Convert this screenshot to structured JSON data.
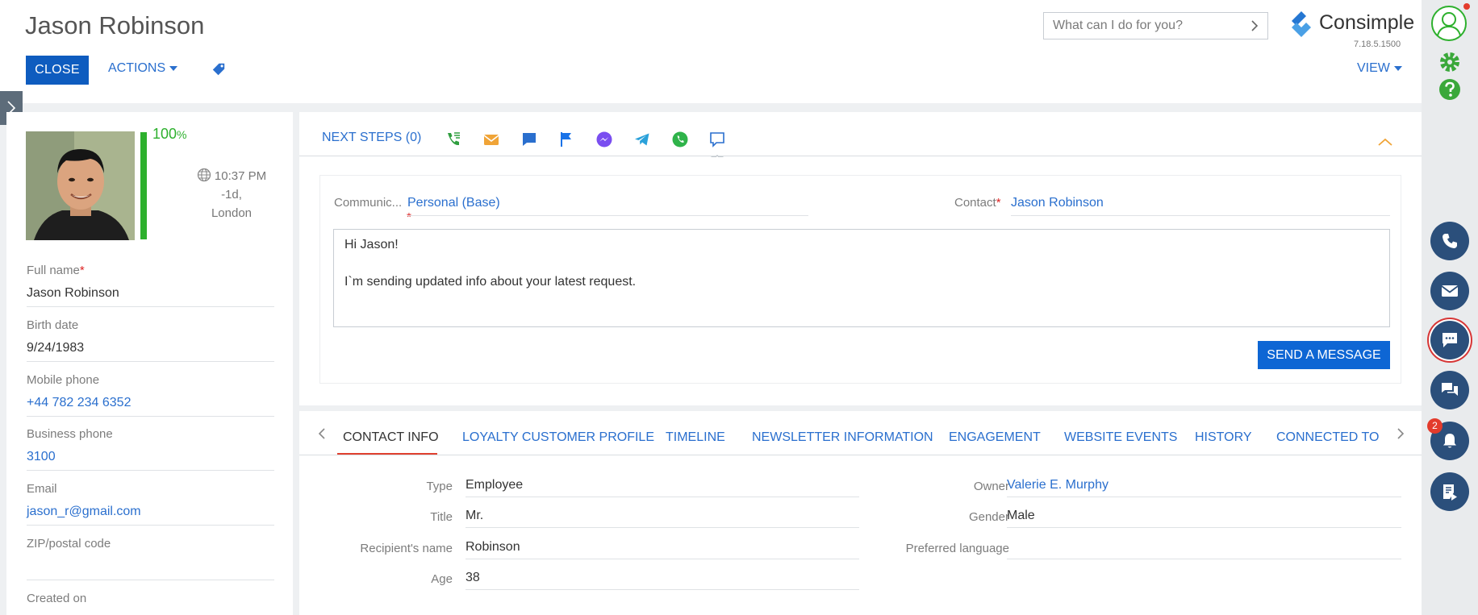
{
  "header": {
    "title": "Jason Robinson",
    "close_label": "CLOSE",
    "actions_label": "ACTIONS",
    "view_label": "VIEW",
    "search_placeholder": "What can I do for you?",
    "logo_text": "Consimple",
    "version": "7.18.5.1500"
  },
  "profile": {
    "completeness_value": "100",
    "completeness_unit": "%",
    "completeness_fraction": 1.0,
    "local_time": "10:37 PM",
    "offset": "-1d,",
    "city": "London"
  },
  "left_fields": [
    {
      "label": "Full name",
      "required": true,
      "value": "Jason Robinson",
      "link": false
    },
    {
      "label": "Birth date",
      "required": false,
      "value": "9/24/1983",
      "link": false
    },
    {
      "label": "Mobile phone",
      "required": false,
      "value": "+44 782 234 6352",
      "link": true
    },
    {
      "label": "Business phone",
      "required": false,
      "value": "3100",
      "link": true
    },
    {
      "label": "Email",
      "required": false,
      "value": "jason_r@gmail.com",
      "link": true
    },
    {
      "label": "ZIP/postal code",
      "required": false,
      "value": "",
      "link": false
    },
    {
      "label": "Created on",
      "required": false,
      "value": "",
      "link": false
    }
  ],
  "next_steps": {
    "label": "NEXT STEPS (0)"
  },
  "compose": {
    "channel_label": "Communic...",
    "channel_value": "Personal (Base)",
    "contact_label": "Contact",
    "contact_value": "Jason Robinson",
    "message_line1": "Hi Jason!",
    "message_line2": "",
    "message_line3": "I`m sending updated info about your latest request.",
    "send_label": "SEND A MESSAGE"
  },
  "detail_tabs": [
    {
      "label": "CONTACT INFO",
      "active": true
    },
    {
      "label": "LOYALTY CUSTOMER PROFILE",
      "active": false
    },
    {
      "label": "TIMELINE",
      "active": false
    },
    {
      "label": "NEWSLETTER INFORMATION",
      "active": false
    },
    {
      "label": "ENGAGEMENT",
      "active": false
    },
    {
      "label": "WEBSITE EVENTS",
      "active": false
    },
    {
      "label": "HISTORY",
      "active": false
    },
    {
      "label": "CONNECTED TO",
      "active": false
    }
  ],
  "contact_info": {
    "left": [
      {
        "label": "Type",
        "value": "Employee"
      },
      {
        "label": "Title",
        "value": "Mr."
      },
      {
        "label": "Recipient's name",
        "value": "Robinson"
      },
      {
        "label": "Age",
        "value": "38"
      }
    ],
    "right": [
      {
        "label": "Owner",
        "value": "Valerie E. Murphy",
        "link": true
      },
      {
        "label": "Gender",
        "value": "Male",
        "link": false
      },
      {
        "label": "Preferred language",
        "value": "",
        "link": false
      }
    ]
  },
  "rail": {
    "notification_count": "2"
  },
  "colors": {
    "accent": "#2a6fce",
    "primary_button": "#0e5cbf",
    "progress": "#2db02d",
    "rail_button": "#2b4f7b",
    "required": "#dd2222"
  }
}
